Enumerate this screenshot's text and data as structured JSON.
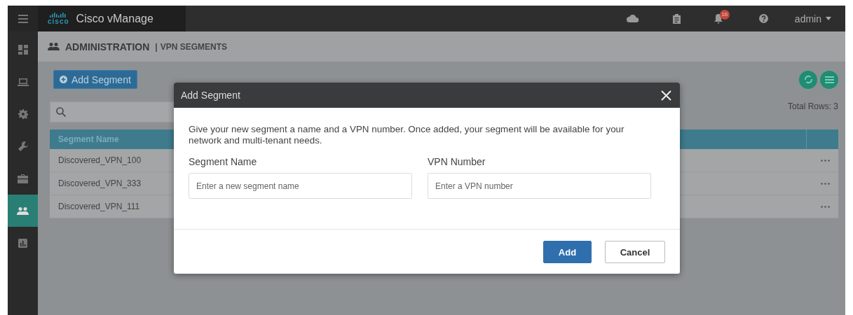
{
  "topbar": {
    "logo_text": "cisco",
    "title": "Cisco vManage",
    "notification_count": "16",
    "user": "admin"
  },
  "sidebar": {
    "items": [
      {
        "kind": "dashboard",
        "selected": false
      },
      {
        "kind": "monitor",
        "selected": false
      },
      {
        "kind": "configuration",
        "selected": false
      },
      {
        "kind": "tools",
        "selected": false
      },
      {
        "kind": "maintenance",
        "selected": false
      },
      {
        "kind": "administration",
        "selected": true
      },
      {
        "kind": "analytics",
        "selected": false
      }
    ]
  },
  "breadcrumb": {
    "section": "ADMINISTRATION",
    "separator": "|",
    "page": "VPN SEGMENTS"
  },
  "toolbar": {
    "add_button": "Add Segment",
    "total_rows": "Total Rows: 3"
  },
  "table": {
    "columns": [
      "Segment Name"
    ],
    "rows": [
      {
        "name": "Discovered_VPN_100"
      },
      {
        "name": "Discovered_VPN_333"
      },
      {
        "name": "Discovered_VPN_111"
      }
    ]
  },
  "modal": {
    "title": "Add Segment",
    "description": "Give your new segment a name and a VPN number. Once added, your segment will be available for your network and multi-tenant needs.",
    "fields": [
      {
        "label": "Segment Name",
        "placeholder": "Enter a new segment name"
      },
      {
        "label": "VPN Number",
        "placeholder": "Enter a VPN number"
      }
    ],
    "buttons": [
      {
        "label": "Add",
        "kind": "primary"
      },
      {
        "label": "Cancel",
        "kind": "secondary"
      }
    ]
  }
}
